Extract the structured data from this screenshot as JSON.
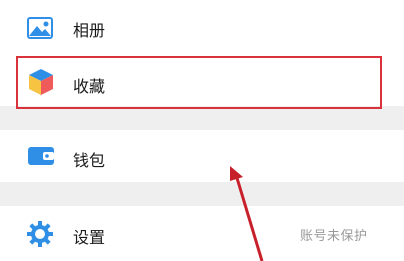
{
  "menu": {
    "album": {
      "label": "相册",
      "icon": "album-image-icon"
    },
    "favorites": {
      "label": "收藏",
      "icon": "favorites-cube-icon"
    },
    "wallet": {
      "label": "钱包",
      "icon": "wallet-icon"
    },
    "settings": {
      "label": "设置",
      "icon": "gear-icon"
    }
  },
  "annotation": {
    "highlight_color": "#d9323a",
    "arrow_color": "#c8202a"
  },
  "watermark": {
    "text": "账号未保护"
  }
}
